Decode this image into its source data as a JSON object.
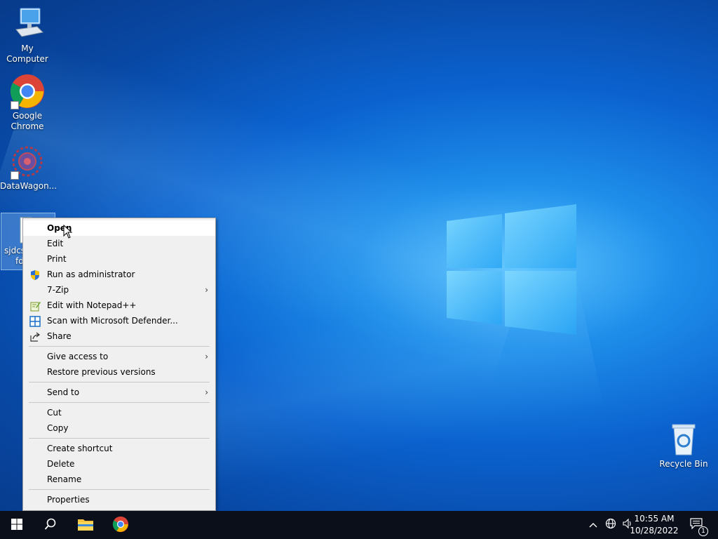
{
  "desktop": {
    "icons": [
      {
        "label": "My Computer",
        "icon": "computer-icon"
      },
      {
        "label": "Google Chrome",
        "icon": "chrome-icon"
      },
      {
        "label": "DataWagon...",
        "icon": "datawagon-icon"
      },
      {
        "label_line1": "sjdcsy",
        "label_line2": "fd",
        "icon": "file-icon"
      },
      {
        "label": "Recycle Bin",
        "icon": "recycle-bin-icon"
      }
    ]
  },
  "context_menu": {
    "items": [
      {
        "label": "Open",
        "bold": true,
        "hover": true
      },
      {
        "label": "Edit"
      },
      {
        "label": "Print"
      },
      {
        "label": "Run as administrator",
        "icon": "uac-shield-icon"
      },
      {
        "label": "7-Zip",
        "submenu": true
      },
      {
        "label": "Edit with Notepad++",
        "icon": "notepad-plus-plus-icon"
      },
      {
        "label": "Scan with Microsoft Defender...",
        "icon": "defender-icon"
      },
      {
        "label": "Share",
        "icon": "share-icon"
      },
      {
        "label": "Give access to",
        "submenu": true
      },
      {
        "label": "Restore previous versions"
      },
      {
        "label": "Send to",
        "submenu": true
      },
      {
        "label": "Cut"
      },
      {
        "label": "Copy"
      },
      {
        "label": "Create shortcut"
      },
      {
        "label": "Delete"
      },
      {
        "label": "Rename"
      },
      {
        "label": "Properties"
      }
    ],
    "submenu_arrow": "›"
  },
  "taskbar": {
    "start_icon": "windows-start-icon",
    "search_icon": "search-icon",
    "pinned": [
      "file-explorer-icon",
      "chrome-icon"
    ],
    "tray": {
      "chevron": "^",
      "time": "10:55 AM",
      "date": "10/28/2022",
      "notification_count": "1"
    }
  },
  "colors": {
    "taskbar": "#0b0f1a",
    "menu_bg": "#f0f0f0",
    "accent": "#0078d7"
  }
}
